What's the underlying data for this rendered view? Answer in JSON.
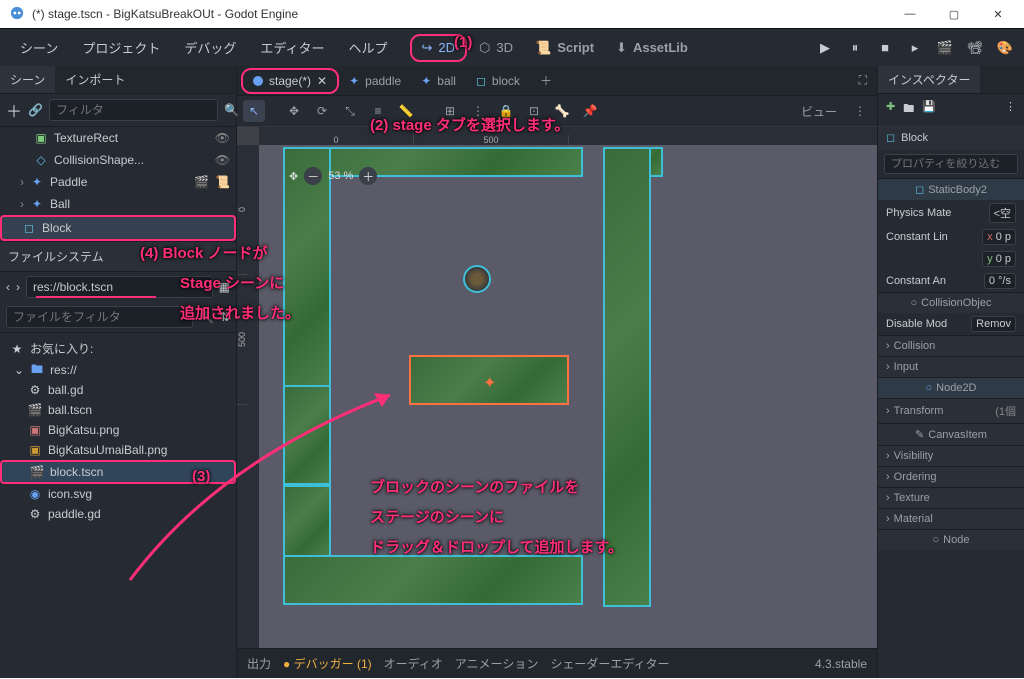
{
  "title": "(*) stage.tscn - BigKatsuBreakOUt - Godot Engine",
  "menu": {
    "scene": "シーン",
    "project": "プロジェクト",
    "debug": "デバッグ",
    "editor": "エディター",
    "help": "ヘルプ"
  },
  "workspace": {
    "2d": "2D",
    "3d": "3D",
    "script": "Script",
    "assetlib": "AssetLib"
  },
  "scene_tabs": {
    "stage": "stage(*)",
    "paddle": "paddle",
    "ball": "ball",
    "block": "block"
  },
  "left_tabs": {
    "scene": "シーン",
    "import": "インポート"
  },
  "scene_toolbar": {
    "filter": "フィルタ"
  },
  "scene_tree": {
    "texturerect": "TextureRect",
    "collisionshape": "CollisionShape...",
    "paddle": "Paddle",
    "ball": "Ball",
    "block": "Block"
  },
  "fs_panel": {
    "title": "ファイルシステム",
    "path": "res://block.tscn",
    "filter": "ファイルをフィルタ",
    "favorites": "お気に入り:",
    "root": "res://",
    "items": {
      "ball_gd": "ball.gd",
      "ball_tscn": "ball.tscn",
      "bigkatsu_png": "BigKatsu.png",
      "bigkatsuumai": "BigKatsuUmaiBall.png",
      "block_tscn": "block.tscn",
      "icon_svg": "icon.svg",
      "paddle_gd": "paddle.gd"
    }
  },
  "viewport": {
    "zoom": "53 %",
    "ruler_h": [
      "0",
      "500"
    ],
    "ruler_v": [
      "0",
      "500"
    ],
    "view_btn": "ビュー"
  },
  "bottom": {
    "output": "出力",
    "debugger": "デバッガー (1)",
    "audio": "オーディオ",
    "anim": "アニメーション",
    "shader": "シェーダーエディター",
    "version": "4.3.stable"
  },
  "inspector": {
    "tab": "インスペクター",
    "nodename": "Block",
    "filter_props": "プロパティを絞り込む",
    "staticbody": "StaticBody2",
    "physics_mate": "Physics Mate",
    "empty": "<空",
    "constant_lin": "Constant Lin",
    "x": "x",
    "y": "y",
    "zero": "0",
    "px": "p",
    "constant_an": "Constant An",
    "deg": "°/s",
    "collisionobj": "CollisionObjec",
    "disable_mod": "Disable Mod",
    "remove": "Remov",
    "collision": "Collision",
    "input": "Input",
    "node2d": "Node2D",
    "transform": "Transform",
    "one_change": "(1個",
    "canvasitem": "CanvasItem",
    "visibility": "Visibility",
    "ordering": "Ordering",
    "texture": "Texture",
    "material": "Material",
    "node": "Node"
  },
  "annotations": {
    "a1": "(1)",
    "a2": "(2) stage タブを選択します。",
    "a3": "(3)",
    "a4a": "(4) Block ノードが",
    "a4b": "Stage シーンに",
    "a4c": "追加されました。",
    "a5a": "ブロックのシーンのファイルを",
    "a5b": "ステージのシーンに",
    "a5c": "ドラッグ＆ドロップして追加します。"
  }
}
